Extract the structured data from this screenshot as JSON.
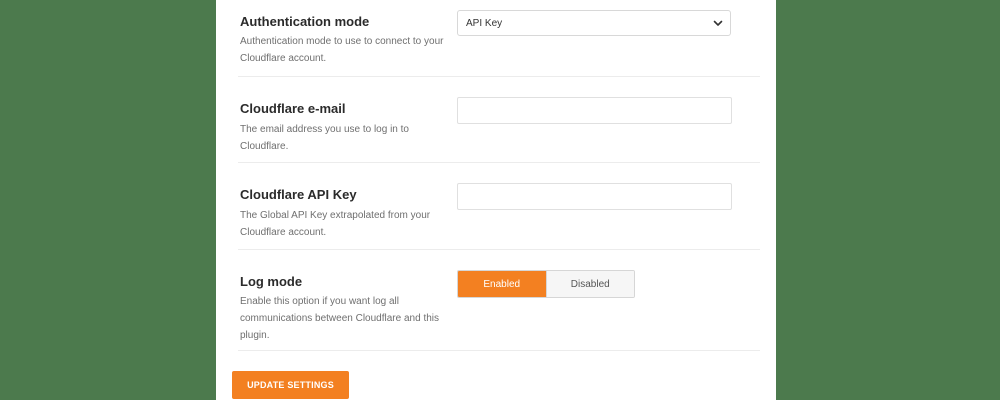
{
  "settings": {
    "auth_mode": {
      "title": "Authentication mode",
      "description": "Authentication mode to use to connect to your Cloudflare account.",
      "selected": "API Key"
    },
    "email": {
      "title": "Cloudflare e-mail",
      "description": "The email address you use to log in to Cloudflare.",
      "value": ""
    },
    "api_key": {
      "title": "Cloudflare API Key",
      "description": "The Global API Key extrapolated from your Cloudflare account.",
      "value": ""
    },
    "log_mode": {
      "title": "Log mode",
      "description": "Enable this option if you want log all communications between Cloudflare and this plugin.",
      "enabled_label": "Enabled",
      "disabled_label": "Disabled",
      "state": "enabled"
    }
  },
  "update_button_label": "UPDATE SETTINGS",
  "icons": {
    "select_chevron": "chevron-down-icon"
  },
  "colors": {
    "accent": "#f38021",
    "background": "#4c7a4d"
  }
}
